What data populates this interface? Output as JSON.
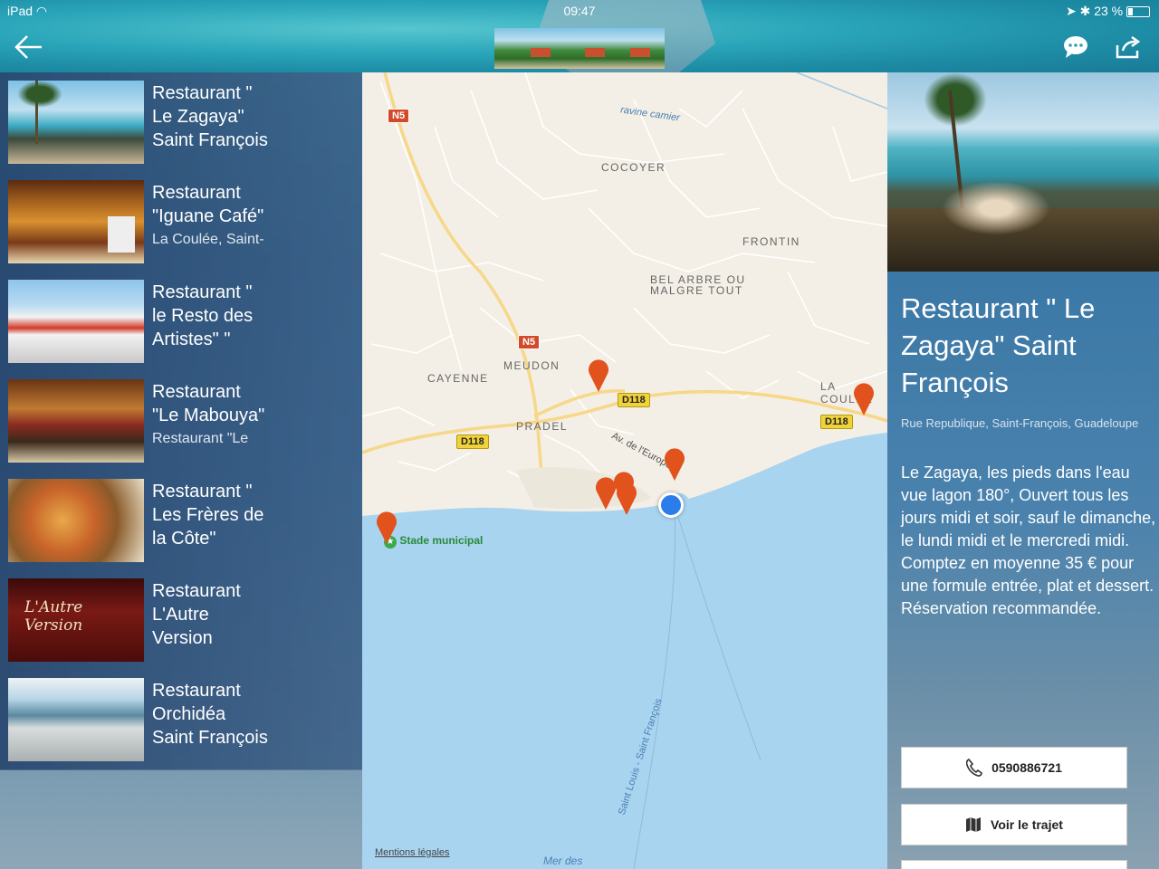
{
  "status": {
    "device": "iPad",
    "time": "09:47",
    "battery": "23 %"
  },
  "colors": {
    "pin": "#e1521d",
    "location_dot": "#2b7de9",
    "water": "#a8d4f0",
    "land": "#f3efe6"
  },
  "list": {
    "items": [
      {
        "line1": "Restaurant \"",
        "line2": "Le Zagaya\"",
        "line3": "Saint François",
        "sub": ""
      },
      {
        "line1": "Restaurant",
        "line2": "\"Iguane Café\"",
        "line3": "",
        "sub": "La Coulée, Saint-"
      },
      {
        "line1": "Restaurant \"",
        "line2": "le Resto des",
        "line3": "Artistes\"  \"",
        "sub": ""
      },
      {
        "line1": "Restaurant",
        "line2": "\"Le Mabouya\"",
        "line3": "",
        "sub": "Restaurant \"Le"
      },
      {
        "line1": "Restaurant \"",
        "line2": "Les Frères de",
        "line3": "la Côte\"",
        "sub": ""
      },
      {
        "line1": "Restaurant",
        "line2": "L'Autre",
        "line3": "Version",
        "sub": ""
      },
      {
        "line1": "Restaurant",
        "line2": "Orchidéa",
        "line3": "Saint François",
        "sub": ""
      }
    ],
    "thumb_text": "L'Autre Version"
  },
  "map": {
    "places": [
      "COCOYER",
      "FRONTIN",
      "BEL ARBRE OU",
      "MALGRE TOUT",
      "CAYENNE",
      "MEUDON",
      "PRADEL",
      "LA COULÉE"
    ],
    "roads": {
      "n5": "N5",
      "d118": "D118"
    },
    "streets": {
      "ravine": "ravine camier",
      "avenue": "Av. de l'Europe",
      "saint_louis": "Saint Louis - Saint François",
      "stade": "Stade municipal"
    },
    "mentions": "Mentions légales",
    "sea": "Mer des"
  },
  "detail": {
    "title": "Restaurant \" Le Zagaya\" Saint François",
    "address": "Rue Republique, Saint-François, Guadeloupe",
    "description": "Le Zagaya, les pieds dans l'eau vue lagon 180°, Ouvert tous les jours midi et soir, sauf le dimanche, le lundi midi et le mercredi midi. Comptez en moyenne 35 € pour une formule entrée, plat et dessert. Réservation recommandée.",
    "phone": "0590886721",
    "route_label": "Voir le trajet"
  }
}
